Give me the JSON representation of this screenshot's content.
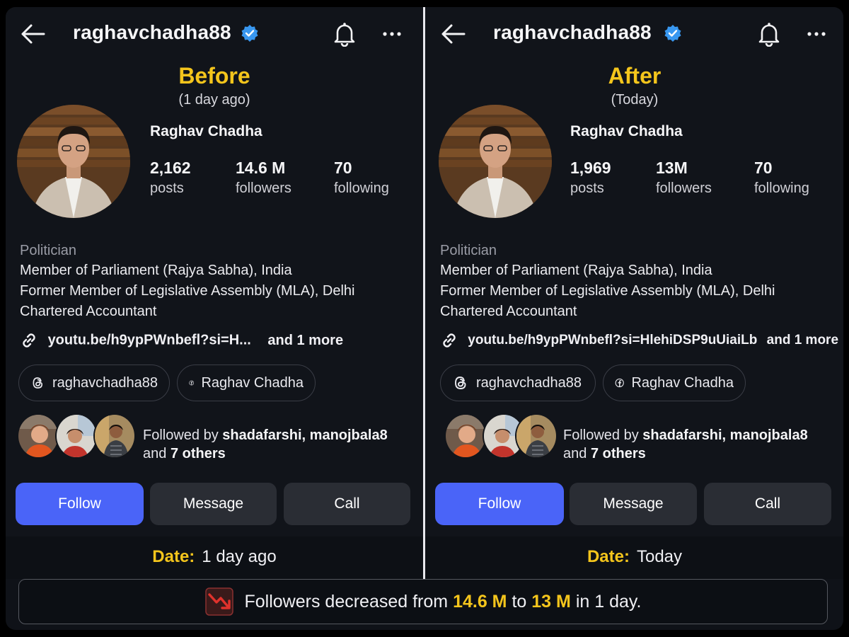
{
  "panels": [
    {
      "username": "raghavchadha88",
      "heading": "Before",
      "subheading": "(1 day ago)",
      "full_name": "Raghav Chadha",
      "stats": [
        {
          "value": "2,162",
          "label": "posts"
        },
        {
          "value": "14.6 M",
          "label": "followers"
        },
        {
          "value": "70",
          "label": "following"
        }
      ],
      "bio": {
        "category": "Politician",
        "lines": [
          "Member of Parliament (Rajya Sabha), India",
          "Former Member of Legislative Assembly (MLA), Delhi",
          "Chartered Accountant"
        ]
      },
      "link": {
        "url": "youtu.be/h9ypPWnbefl?si=H...",
        "more": "and 1 more"
      },
      "chips": [
        {
          "icon": "threads-icon",
          "label": "raghavchadha88"
        },
        {
          "icon": "facebook-icon",
          "label": "Raghav Chadha"
        }
      ],
      "followed_by": {
        "prefix": "Followed by",
        "names": "shadafarshi, manojbala8",
        "and": "and",
        "others": "7 others"
      },
      "buttons": {
        "follow": "Follow",
        "message": "Message",
        "call": "Call"
      },
      "date": {
        "key": "Date:",
        "value": "1 day ago"
      }
    },
    {
      "username": "raghavchadha88",
      "heading": "After",
      "subheading": "(Today)",
      "full_name": "Raghav Chadha",
      "stats": [
        {
          "value": "1,969",
          "label": "posts"
        },
        {
          "value": "13M",
          "label": "followers"
        },
        {
          "value": "70",
          "label": "following"
        }
      ],
      "bio": {
        "category": "Politician",
        "lines": [
          "Member of Parliament (Rajya Sabha), India",
          "Former Member of Legislative Assembly (MLA), Delhi",
          "Chartered Accountant"
        ]
      },
      "link": {
        "url": "youtu.be/h9ypPWnbefl?si=HlehiDSP9uUiaiLb",
        "more": "and 1 more"
      },
      "chips": [
        {
          "icon": "threads-icon",
          "label": "raghavchadha88"
        },
        {
          "icon": "facebook-icon",
          "label": "Raghav Chadha"
        }
      ],
      "followed_by": {
        "prefix": "Followed by",
        "names": "shadafarshi, manojbala8",
        "and": "and",
        "others": "7 others"
      },
      "buttons": {
        "follow": "Follow",
        "message": "Message",
        "call": "Call"
      },
      "date": {
        "key": "Date:",
        "value": "Today"
      }
    }
  ],
  "icons": {
    "back": "arrow-left-icon",
    "verified": "verified-badge-icon",
    "notifications": "bell-icon",
    "more": "more-horizontal-icon",
    "link": "link-icon",
    "trend": "trending-down-icon"
  },
  "colors": {
    "accent_yellow": "#f4c51c",
    "follow_blue": "#4a64f8",
    "verified_blue": "#3897f0",
    "background": "#11141a",
    "trend_red": "#e0322c"
  },
  "summary": {
    "pre": "Followers decreased from",
    "from": "14.6 M",
    "mid": "to",
    "to": "13 M",
    "post": "in 1 day."
  }
}
